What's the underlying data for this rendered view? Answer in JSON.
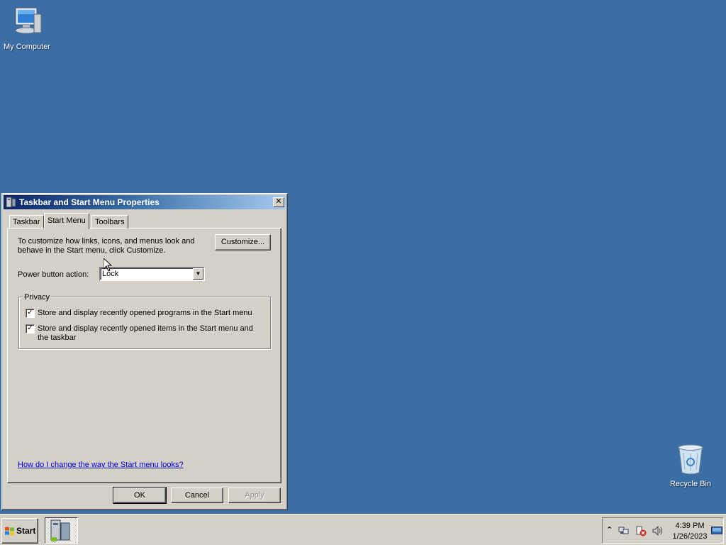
{
  "desktop": {
    "icons": [
      {
        "label": "My Computer",
        "icon": "computer-icon"
      },
      {
        "label": "Recycle Bin",
        "icon": "recycle-bin-icon"
      }
    ],
    "background_color": "#3a6ea5"
  },
  "dialog": {
    "title": "Taskbar and Start Menu Properties",
    "tabs": [
      {
        "label": "Taskbar",
        "active": false
      },
      {
        "label": "Start Menu",
        "active": true
      },
      {
        "label": "Toolbars",
        "active": false
      }
    ],
    "info_text": "To customize how links, icons, and menus look and behave in the Start menu, click Customize.",
    "customize_label": "Customize...",
    "power_label": "Power button action:",
    "power_value": "Lock",
    "privacy": {
      "legend": "Privacy",
      "items": [
        {
          "label": "Store and display recently opened programs in the Start menu",
          "checked": true
        },
        {
          "label": "Store and display recently opened items in the Start menu and the taskbar",
          "checked": true
        }
      ]
    },
    "help_link": "How do I change the way the Start menu looks?",
    "buttons": {
      "ok": "OK",
      "cancel": "Cancel",
      "apply": "Apply"
    }
  },
  "taskbar": {
    "start_label": "Start",
    "clock_time": "4:39 PM",
    "clock_date": "1/26/2023",
    "tray_icons": [
      "chevron-up-icon",
      "network-icon",
      "action-center-icon",
      "volume-icon",
      "show-desktop-icon"
    ]
  }
}
